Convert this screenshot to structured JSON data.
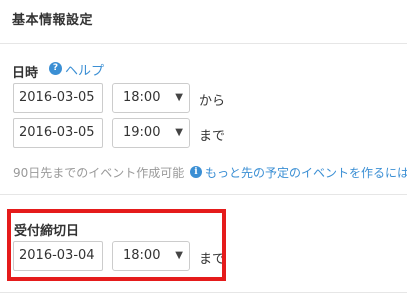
{
  "section": {
    "title": "基本情報設定"
  },
  "datetime": {
    "label": "日時",
    "help_icon": "question-circle-icon",
    "help_label": "ヘルプ",
    "start": {
      "date": "2016-03-05",
      "time": "18:00",
      "suffix": "から"
    },
    "end": {
      "date": "2016-03-05",
      "time": "19:00",
      "suffix": "まで"
    },
    "note": "90日先までのイベント作成可能",
    "info_icon": "info-circle-icon",
    "note_link": "もっと先の予定のイベントを作るには"
  },
  "deadline": {
    "label": "受付締切日",
    "date": "2016-03-04",
    "time": "18:00",
    "suffix": "まで"
  },
  "colors": {
    "accent": "#3b8fd4",
    "highlight": "#e51b1b",
    "border": "#cccccc"
  }
}
